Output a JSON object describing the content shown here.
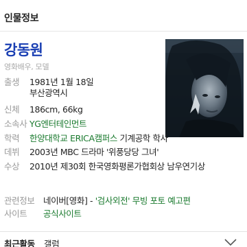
{
  "section": {
    "title": "인물정보"
  },
  "profile": {
    "name": "강동원",
    "subtitle": "영화배우, 모델"
  },
  "info": {
    "birth": {
      "label": "출생",
      "date": "1981년 1월 18일",
      "place": "부산광역시"
    },
    "body": {
      "label": "신체",
      "value": "186cm, 66kg"
    },
    "agency": {
      "label": "소속사",
      "value": "YG엔터테인먼트"
    },
    "education": {
      "label": "학력",
      "school": "한양대학교 ERICA캠퍼스",
      "major": " 기계공학 학사"
    },
    "debut": {
      "label": "데뷔",
      "value": "2003년 MBC 드라마 '위풍당당 그녀'"
    },
    "award": {
      "label": "수상",
      "value": "2010년 제30회 한국영화평론가협회상 남우연기상"
    },
    "related": {
      "label": "관련정보",
      "source": "네이버[영화]",
      "sep": " - ",
      "title": "'검사외전'",
      "links": " 무빙 포토 예고편"
    },
    "site": {
      "label": "사이트",
      "value": "공식사이트"
    }
  },
  "bottom": {
    "title": "최근활동",
    "sub": "갤럼"
  },
  "icons": {
    "photo": "profile-photo",
    "expand": "chevron-down-icon"
  },
  "colors": {
    "link_blue": "#1a3fb3",
    "link_green": "#1a7a2e",
    "label_gray": "#9a9a9a"
  }
}
